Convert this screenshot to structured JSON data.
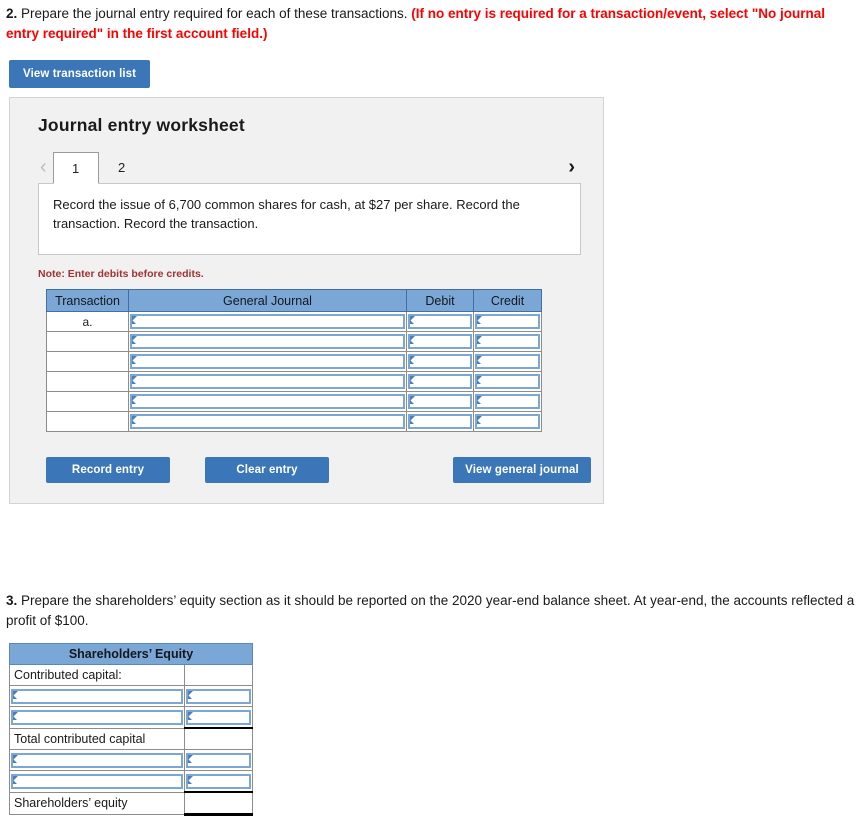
{
  "question2": {
    "number": "2.",
    "text": " Prepare the journal entry required for each of these transactions. ",
    "red_note": "(If no entry is required for a transaction/event, select \"No journal entry required\" in the first account field.)"
  },
  "view_transaction_list_button": "View transaction list",
  "worksheet": {
    "title": "Journal entry worksheet",
    "nav": {
      "prev_icon": "chevron-left-icon",
      "prev_glyph": "‹",
      "next_icon": "chevron-right-icon",
      "next_glyph": "›"
    },
    "tabs": [
      {
        "label": "1",
        "active": true
      },
      {
        "label": "2",
        "active": false
      }
    ],
    "prompt": "Record the issue of 6,700 common shares for cash, at $27 per share. Record the transaction. Record the transaction.",
    "note": "Note: Enter debits before credits.",
    "table": {
      "headers": [
        "Transaction",
        "General Journal",
        "Debit",
        "Credit"
      ],
      "rows": [
        {
          "transaction": "a.",
          "general_journal": "",
          "debit": "",
          "credit": ""
        },
        {
          "transaction": "",
          "general_journal": "",
          "debit": "",
          "credit": ""
        },
        {
          "transaction": "",
          "general_journal": "",
          "debit": "",
          "credit": ""
        },
        {
          "transaction": "",
          "general_journal": "",
          "debit": "",
          "credit": ""
        },
        {
          "transaction": "",
          "general_journal": "",
          "debit": "",
          "credit": ""
        },
        {
          "transaction": "",
          "general_journal": "",
          "debit": "",
          "credit": ""
        }
      ]
    },
    "buttons": {
      "record_entry": "Record entry",
      "clear_entry": "Clear entry",
      "view_general_journal": "View general journal"
    }
  },
  "question3": {
    "number": "3.",
    "text": " Prepare the shareholders’ equity section as it should be reported on the 2020 year-end balance sheet. At year-end, the accounts reflected a profit of $100."
  },
  "equity_table": {
    "header": "Shareholders’ Equity",
    "rows": [
      {
        "label": "Contributed capital:",
        "label_is_input": false,
        "value_is_input": false,
        "value": "",
        "value_topline": false,
        "value_botline": false
      },
      {
        "label": "",
        "label_is_input": true,
        "value_is_input": true,
        "value": "",
        "value_topline": false,
        "value_botline": false
      },
      {
        "label": "",
        "label_is_input": true,
        "value_is_input": true,
        "value": "",
        "value_topline": false,
        "value_botline": false
      },
      {
        "label": "Total contributed capital",
        "label_is_input": false,
        "value_is_input": false,
        "value": "",
        "value_topline": true,
        "value_botline": false
      },
      {
        "label": "",
        "label_is_input": true,
        "value_is_input": true,
        "value": "",
        "value_topline": false,
        "value_botline": false
      },
      {
        "label": "",
        "label_is_input": true,
        "value_is_input": true,
        "value": "",
        "value_topline": false,
        "value_botline": false
      },
      {
        "label": "Shareholders’ equity",
        "label_is_input": false,
        "value_is_input": false,
        "value": "",
        "value_topline": true,
        "value_botline": true
      }
    ]
  },
  "colors": {
    "header_blue": "#7ba7d7",
    "button_blue": "#3b77b8",
    "panel_gray": "#f1f1f1",
    "note_red": "#a33232",
    "alert_red": "#ff0000"
  }
}
